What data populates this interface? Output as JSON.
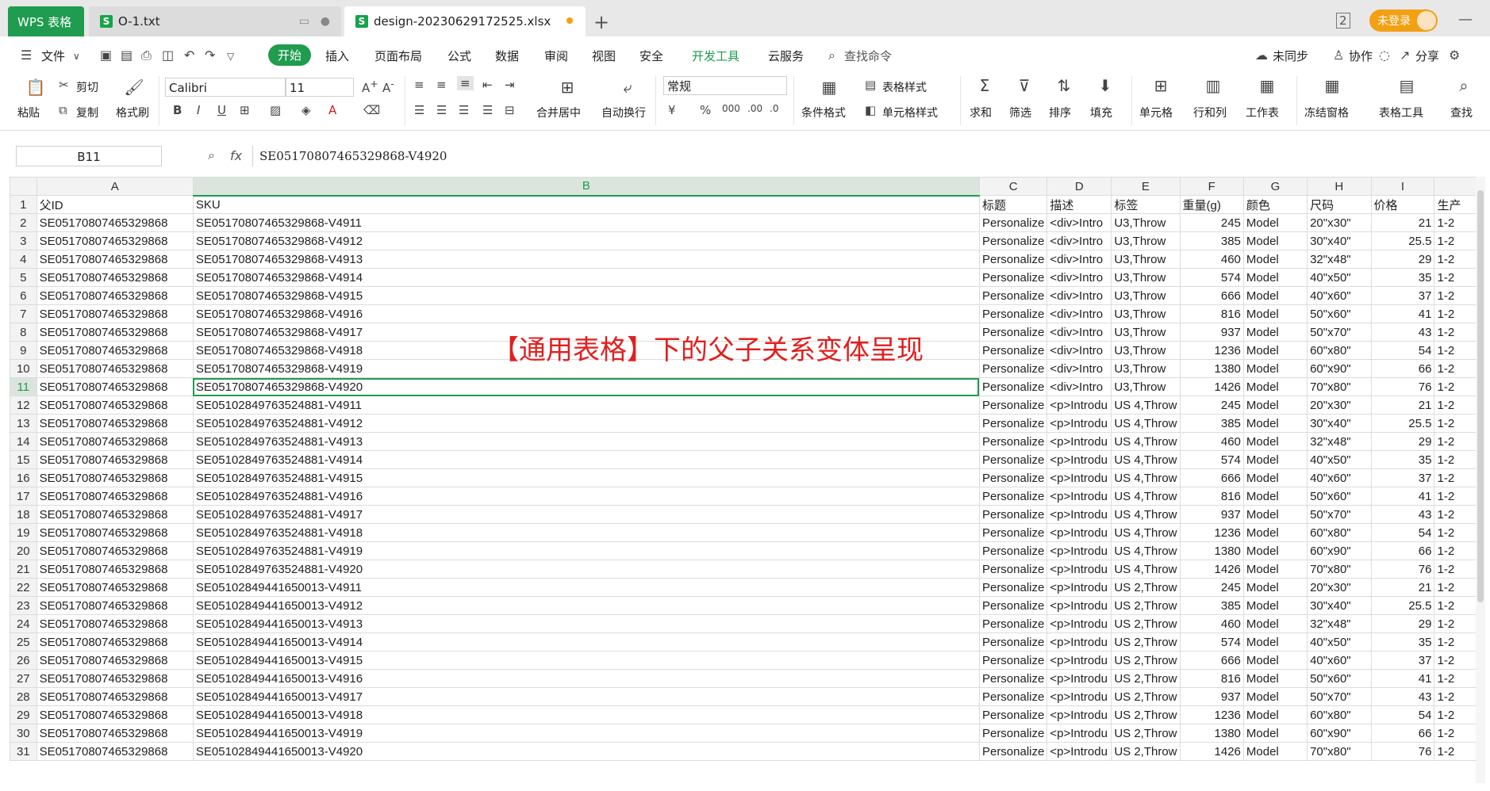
{
  "titlebar": {
    "app_tab": "WPS 表格",
    "tabs": [
      {
        "label": "O-1.txt"
      },
      {
        "label": "design-20230629172525.xlsx"
      }
    ],
    "login_label": "未登录"
  },
  "menu": {
    "file": "文件",
    "tabs": [
      "开始",
      "插入",
      "页面布局",
      "公式",
      "数据",
      "审阅",
      "视图",
      "安全",
      "开发工具",
      "云服务"
    ],
    "search_placeholder": "查找命令",
    "right": [
      "未同步",
      "协作",
      "分享"
    ]
  },
  "ribbon": {
    "paste": "粘贴",
    "cut": "剪切",
    "copy": "复制",
    "format_painter": "格式刷",
    "font_name": "Calibri",
    "font_size": "11",
    "merge_center": "合并居中",
    "wrap": "自动换行",
    "number_format": "常规",
    "cond_format": "条件格式",
    "table_style": "表格样式",
    "cell_style": "单元格样式",
    "sum": "求和",
    "filter": "筛选",
    "sort": "排序",
    "fill": "填充",
    "cells": "单元格",
    "rows_cols": "行和列",
    "worksheet": "工作表",
    "freeze": "冻结窗格",
    "table_tools": "表格工具",
    "find": "查找"
  },
  "formula_bar": {
    "name_box": "B11",
    "fx": "fx",
    "value": "SE05170807465329868-V4920"
  },
  "sheet": {
    "columns": [
      "A",
      "B",
      "C",
      "D",
      "E",
      "F",
      "G",
      "H",
      "I",
      ""
    ],
    "header_row": [
      "父ID",
      "SKU",
      "标题",
      "描述",
      "标签",
      "重量(g)",
      "颜色",
      "尺码",
      "价格",
      "生产"
    ],
    "rows": [
      [
        "SE05170807465329868",
        "SE05170807465329868-V4911",
        "Personalize",
        "<div>Intro",
        "U3,Throw",
        "245",
        "Model",
        "20\"x30\"",
        "21",
        "1-2"
      ],
      [
        "SE05170807465329868",
        "SE05170807465329868-V4912",
        "Personalize",
        "<div>Intro",
        "U3,Throw",
        "385",
        "Model",
        "30\"x40\"",
        "25.5",
        "1-2"
      ],
      [
        "SE05170807465329868",
        "SE05170807465329868-V4913",
        "Personalize",
        "<div>Intro",
        "U3,Throw",
        "460",
        "Model",
        "32\"x48\"",
        "29",
        "1-2"
      ],
      [
        "SE05170807465329868",
        "SE05170807465329868-V4914",
        "Personalize",
        "<div>Intro",
        "U3,Throw",
        "574",
        "Model",
        "40\"x50\"",
        "35",
        "1-2"
      ],
      [
        "SE05170807465329868",
        "SE05170807465329868-V4915",
        "Personalize",
        "<div>Intro",
        "U3,Throw",
        "666",
        "Model",
        "40\"x60\"",
        "37",
        "1-2"
      ],
      [
        "SE05170807465329868",
        "SE05170807465329868-V4916",
        "Personalize",
        "<div>Intro",
        "U3,Throw",
        "816",
        "Model",
        "50\"x60\"",
        "41",
        "1-2"
      ],
      [
        "SE05170807465329868",
        "SE05170807465329868-V4917",
        "Personalize",
        "<div>Intro",
        "U3,Throw",
        "937",
        "Model",
        "50\"x70\"",
        "43",
        "1-2"
      ],
      [
        "SE05170807465329868",
        "SE05170807465329868-V4918",
        "Personalize",
        "<div>Intro",
        "U3,Throw",
        "1236",
        "Model",
        "60\"x80\"",
        "54",
        "1-2"
      ],
      [
        "SE05170807465329868",
        "SE05170807465329868-V4919",
        "Personalize",
        "<div>Intro",
        "U3,Throw",
        "1380",
        "Model",
        "60\"x90\"",
        "66",
        "1-2"
      ],
      [
        "SE05170807465329868",
        "SE05170807465329868-V4920",
        "Personalize",
        "<div>Intro",
        "U3,Throw",
        "1426",
        "Model",
        "70\"x80\"",
        "76",
        "1-2"
      ],
      [
        "SE05170807465329868",
        "SE05102849763524881-V4911",
        "Personalize",
        "<p>Introdu",
        "US 4,Throw",
        "245",
        "Model",
        "20\"x30\"",
        "21",
        "1-2"
      ],
      [
        "SE05170807465329868",
        "SE05102849763524881-V4912",
        "Personalize",
        "<p>Introdu",
        "US 4,Throw",
        "385",
        "Model",
        "30\"x40\"",
        "25.5",
        "1-2"
      ],
      [
        "SE05170807465329868",
        "SE05102849763524881-V4913",
        "Personalize",
        "<p>Introdu",
        "US 4,Throw",
        "460",
        "Model",
        "32\"x48\"",
        "29",
        "1-2"
      ],
      [
        "SE05170807465329868",
        "SE05102849763524881-V4914",
        "Personalize",
        "<p>Introdu",
        "US 4,Throw",
        "574",
        "Model",
        "40\"x50\"",
        "35",
        "1-2"
      ],
      [
        "SE05170807465329868",
        "SE05102849763524881-V4915",
        "Personalize",
        "<p>Introdu",
        "US 4,Throw",
        "666",
        "Model",
        "40\"x60\"",
        "37",
        "1-2"
      ],
      [
        "SE05170807465329868",
        "SE05102849763524881-V4916",
        "Personalize",
        "<p>Introdu",
        "US 4,Throw",
        "816",
        "Model",
        "50\"x60\"",
        "41",
        "1-2"
      ],
      [
        "SE05170807465329868",
        "SE05102849763524881-V4917",
        "Personalize",
        "<p>Introdu",
        "US 4,Throw",
        "937",
        "Model",
        "50\"x70\"",
        "43",
        "1-2"
      ],
      [
        "SE05170807465329868",
        "SE05102849763524881-V4918",
        "Personalize",
        "<p>Introdu",
        "US 4,Throw",
        "1236",
        "Model",
        "60\"x80\"",
        "54",
        "1-2"
      ],
      [
        "SE05170807465329868",
        "SE05102849763524881-V4919",
        "Personalize",
        "<p>Introdu",
        "US 4,Throw",
        "1380",
        "Model",
        "60\"x90\"",
        "66",
        "1-2"
      ],
      [
        "SE05170807465329868",
        "SE05102849763524881-V4920",
        "Personalize",
        "<p>Introdu",
        "US 4,Throw",
        "1426",
        "Model",
        "70\"x80\"",
        "76",
        "1-2"
      ],
      [
        "SE05170807465329868",
        "SE05102849441650013-V4911",
        "Personalize",
        "<p>Introdu",
        "US 2,Throw",
        "245",
        "Model",
        "20\"x30\"",
        "21",
        "1-2"
      ],
      [
        "SE05170807465329868",
        "SE05102849441650013-V4912",
        "Personalize",
        "<p>Introdu",
        "US 2,Throw",
        "385",
        "Model",
        "30\"x40\"",
        "25.5",
        "1-2"
      ],
      [
        "SE05170807465329868",
        "SE05102849441650013-V4913",
        "Personalize",
        "<p>Introdu",
        "US 2,Throw",
        "460",
        "Model",
        "32\"x48\"",
        "29",
        "1-2"
      ],
      [
        "SE05170807465329868",
        "SE05102849441650013-V4914",
        "Personalize",
        "<p>Introdu",
        "US 2,Throw",
        "574",
        "Model",
        "40\"x50\"",
        "35",
        "1-2"
      ],
      [
        "SE05170807465329868",
        "SE05102849441650013-V4915",
        "Personalize",
        "<p>Introdu",
        "US 2,Throw",
        "666",
        "Model",
        "40\"x60\"",
        "37",
        "1-2"
      ],
      [
        "SE05170807465329868",
        "SE05102849441650013-V4916",
        "Personalize",
        "<p>Introdu",
        "US 2,Throw",
        "816",
        "Model",
        "50\"x60\"",
        "41",
        "1-2"
      ],
      [
        "SE05170807465329868",
        "SE05102849441650013-V4917",
        "Personalize",
        "<p>Introdu",
        "US 2,Throw",
        "937",
        "Model",
        "50\"x70\"",
        "43",
        "1-2"
      ],
      [
        "SE05170807465329868",
        "SE05102849441650013-V4918",
        "Personalize",
        "<p>Introdu",
        "US 2,Throw",
        "1236",
        "Model",
        "60\"x80\"",
        "54",
        "1-2"
      ],
      [
        "SE05170807465329868",
        "SE05102849441650013-V4919",
        "Personalize",
        "<p>Introdu",
        "US 2,Throw",
        "1380",
        "Model",
        "60\"x90\"",
        "66",
        "1-2"
      ],
      [
        "SE05170807465329868",
        "SE05102849441650013-V4920",
        "Personalize",
        "<p>Introdu",
        "US 2,Throw",
        "1426",
        "Model",
        "70\"x80\"",
        "76",
        "1-2"
      ]
    ],
    "selected_row": 11
  },
  "overlay_caption": "【通用表格】下的父子关系变体呈现",
  "colors": {
    "accent": "#1f9c4f",
    "caption": "#e02020",
    "login": "#f2a014"
  }
}
